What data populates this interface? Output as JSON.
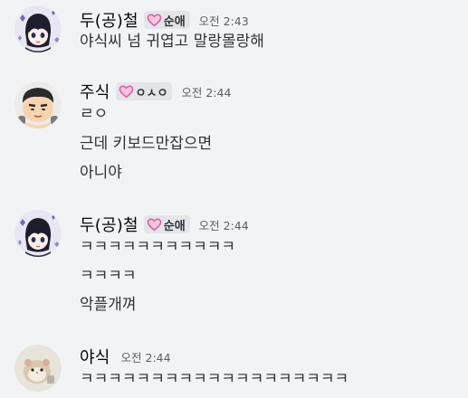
{
  "colors": {
    "background": "#f2f3f5",
    "text": "#2e3338",
    "username": "#060607",
    "timestamp": "#5c5e66",
    "heart_stroke": "#d85aa7",
    "heart_fill": "#f7c6dd",
    "tag_bg": "#e3e5e8"
  },
  "messages": [
    {
      "username": "두(공)철",
      "role_tag": "순애",
      "timestamp": "오전 2:43",
      "avatar": "anime-boy-avatar",
      "lines": [
        "야식씨 넘 귀엽고 말랑몰랑해"
      ]
    },
    {
      "username": "주식",
      "role_tag": "ㅇㅅㅇ",
      "timestamp": "오전 2:44",
      "avatar": "cartoon-boy-avatar",
      "lines": [
        "ㄹㅇ",
        "근데 키보드만잡으면",
        "아니야"
      ]
    },
    {
      "username": "두(공)철",
      "role_tag": "순애",
      "timestamp": "오전 2:44",
      "avatar": "anime-boy-avatar",
      "lines": [
        "ㅋㅋㅋㅋㅋㅋㅋㅋㅋㅋㅋ",
        "ㅋㅋㅋㅋ",
        "악플개껴"
      ]
    },
    {
      "username": "야식",
      "role_tag": "",
      "timestamp": "오전 2:44",
      "avatar": "hamster-avatar",
      "lines": [
        "ㅋㅋㅋㅋㅋㅋㅋㅋㅋㅋㅋㅋㅋㅋㅋㅋㅋㅋㅋ"
      ]
    }
  ]
}
